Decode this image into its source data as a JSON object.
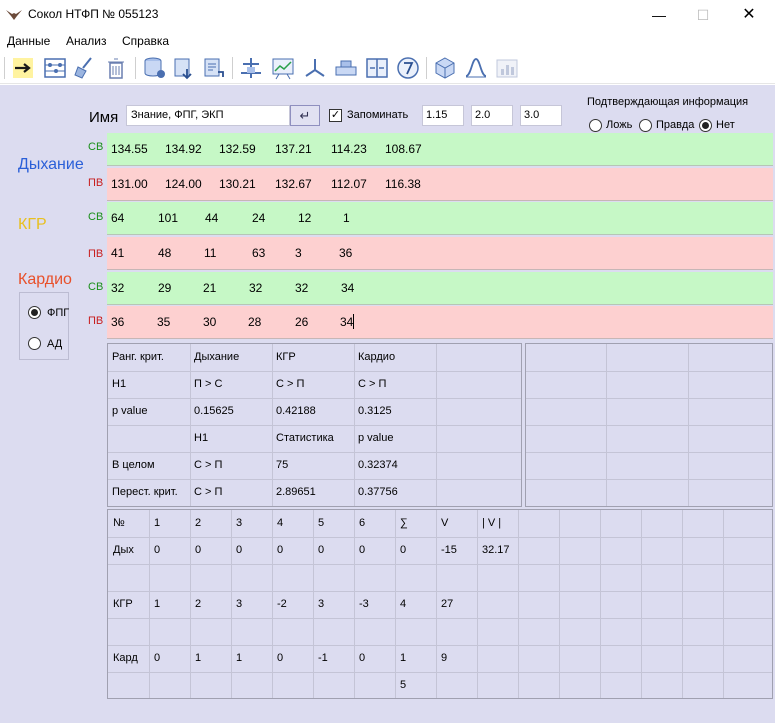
{
  "window": {
    "title": "Сокол НТФП  № 055123",
    "minimize": "—",
    "maximize": "☐",
    "close": "✕"
  },
  "menu": [
    "Данные",
    "Анализ",
    "Справка"
  ],
  "toolbar": [
    "arrow-right-icon",
    "abacus-icon",
    "broom-icon",
    "trash-icon",
    "database-icon",
    "save-arrow-icon",
    "export-icon",
    "measure-icon",
    "chart-board-icon",
    "axes-icon",
    "levels-icon",
    "split-icon",
    "number-7-icon",
    "cube-icon",
    "bell-curve-icon",
    "bar-chart-icon"
  ],
  "header": {
    "name_label": "Имя",
    "name_value": "Знание, ФПГ, ЭКП",
    "enter_glyph": "↵",
    "check_mark": "✓",
    "remember_label": "Запоминать",
    "inputs": [
      "1.15",
      "2.0",
      "3.0"
    ],
    "confirm_title": "Подтверждающая информация",
    "confirm_options": [
      "Ложь",
      "Правда",
      "Нет"
    ],
    "confirm_selected": "Нет"
  },
  "groups": {
    "breathing": {
      "label": "Дыхание",
      "color": "#2a5fd8"
    },
    "kgr": {
      "label": "КГР",
      "color": "#e8c020"
    },
    "cardio": {
      "label": "Кардио",
      "color": "#e8502a"
    }
  },
  "row_tags": {
    "sv": "СВ",
    "pv": "ПВ"
  },
  "rows": [
    {
      "tag": "СВ",
      "values": [
        "134.55",
        "134.92",
        "132.59",
        "137.21",
        "114.23",
        "108.67"
      ]
    },
    {
      "tag": "ПВ",
      "values": [
        "131.00",
        "124.00",
        "130.21",
        "132.67",
        "112.07",
        "116.38"
      ]
    },
    {
      "tag": "СВ",
      "values": [
        "64",
        "101",
        "44",
        "24",
        "12",
        "1"
      ]
    },
    {
      "tag": "ПВ",
      "values": [
        "41",
        "48",
        "11",
        "63",
        "3",
        "36"
      ]
    },
    {
      "tag": "СВ",
      "values": [
        "32",
        "29",
        "21",
        "32",
        "32",
        "34"
      ]
    },
    {
      "tag": "ПВ",
      "values": [
        "36",
        "35",
        "30",
        "28",
        "26",
        "34"
      ]
    }
  ],
  "mode": {
    "options": [
      "ФПГ",
      "АД"
    ],
    "selected": "ФПГ"
  },
  "criteria_table": [
    [
      "Ранг. крит.",
      "Дыхание",
      "КГР",
      "Кардио",
      ""
    ],
    [
      "H1",
      "П > С",
      "С > П",
      "С > П",
      ""
    ],
    [
      "p value",
      "0.15625",
      "0.42188",
      "0.3125",
      ""
    ],
    [
      "",
      "H1",
      "Статистика",
      "p value",
      ""
    ],
    [
      "В целом",
      "С > П",
      "75",
      "0.32374",
      ""
    ],
    [
      "Перест. крит.",
      "С > П",
      "2.89651",
      "0.37756",
      ""
    ]
  ],
  "scores_table": [
    [
      "№",
      "1",
      "2",
      "3",
      "4",
      "5",
      "6",
      "∑",
      "V",
      "| V |"
    ],
    [
      "Дых",
      "0",
      "0",
      "0",
      "0",
      "0",
      "0",
      "0",
      "-15",
      "32.17"
    ],
    [
      "",
      "",
      "",
      "",
      "",
      "",
      "",
      "",
      "",
      ""
    ],
    [
      "КГР",
      "1",
      "2",
      "3",
      "-2",
      "3",
      "-3",
      "4",
      "27",
      ""
    ],
    [
      "",
      "",
      "",
      "",
      "",
      "",
      "",
      "",
      "",
      ""
    ],
    [
      "Кард",
      "0",
      "1",
      "1",
      "0",
      "-1",
      "0",
      "1",
      "9",
      ""
    ],
    [
      "",
      "",
      "",
      "",
      "",
      "",
      "",
      "5",
      "",
      ""
    ]
  ]
}
